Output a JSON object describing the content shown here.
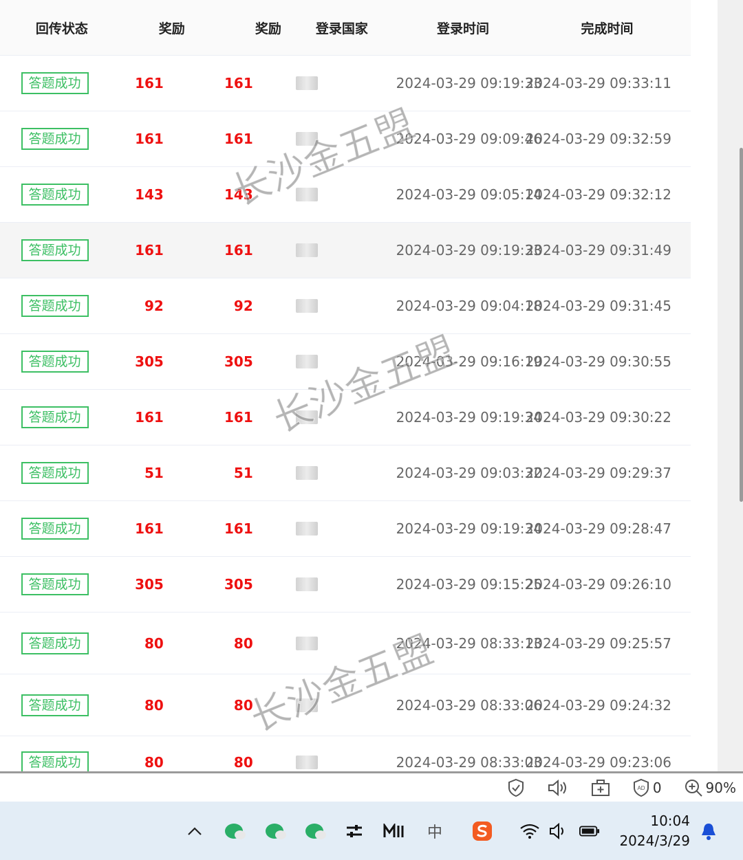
{
  "table": {
    "headers": {
      "status": "回传状态",
      "reward1": "奖励",
      "reward2": "奖励",
      "country": "登录国家",
      "login_time": "登录时间",
      "done_time": "完成时间"
    },
    "rows": [
      {
        "status": "答题成功",
        "reward1": "161",
        "reward2": "161",
        "login": "2024-03-29 09:19:33",
        "done": "2024-03-29 09:33:11"
      },
      {
        "status": "答题成功",
        "reward1": "161",
        "reward2": "161",
        "login": "2024-03-29 09:09:46",
        "done": "2024-03-29 09:32:59"
      },
      {
        "status": "答题成功",
        "reward1": "143",
        "reward2": "143",
        "login": "2024-03-29 09:05:14",
        "done": "2024-03-29 09:32:12"
      },
      {
        "status": "答题成功",
        "reward1": "161",
        "reward2": "161",
        "login": "2024-03-29 09:19:33",
        "done": "2024-03-29 09:31:49"
      },
      {
        "status": "答题成功",
        "reward1": "92",
        "reward2": "92",
        "login": "2024-03-29 09:04:18",
        "done": "2024-03-29 09:31:45"
      },
      {
        "status": "答题成功",
        "reward1": "305",
        "reward2": "305",
        "login": "2024-03-29 09:16:19",
        "done": "2024-03-29 09:30:55"
      },
      {
        "status": "答题成功",
        "reward1": "161",
        "reward2": "161",
        "login": "2024-03-29 09:19:34",
        "done": "2024-03-29 09:30:22"
      },
      {
        "status": "答题成功",
        "reward1": "51",
        "reward2": "51",
        "login": "2024-03-29 09:03:32",
        "done": "2024-03-29 09:29:37"
      },
      {
        "status": "答题成功",
        "reward1": "161",
        "reward2": "161",
        "login": "2024-03-29 09:19:34",
        "done": "2024-03-29 09:28:47"
      },
      {
        "status": "答题成功",
        "reward1": "305",
        "reward2": "305",
        "login": "2024-03-29 09:15:25",
        "done": "2024-03-29 09:26:10"
      },
      {
        "status": "答题成功",
        "reward1": "80",
        "reward2": "80",
        "login": "2024-03-29 08:33:13",
        "done": "2024-03-29 09:25:57"
      },
      {
        "status": "答题成功",
        "reward1": "80",
        "reward2": "80",
        "login": "2024-03-29 08:33:06",
        "done": "2024-03-29 09:24:32"
      },
      {
        "status": "答题成功",
        "reward1": "80",
        "reward2": "80",
        "login": "2024-03-29 08:33:03",
        "done": "2024-03-29 09:23:06"
      }
    ],
    "highlighted_row": 3
  },
  "watermark": "长沙金五盟",
  "statusbar": {
    "adblock_count": "0",
    "zoom": "90%",
    "icons": [
      "shield-check-icon",
      "speaker-icon",
      "add-tab-icon",
      "adblock-icon",
      "zoom-icon"
    ]
  },
  "taskbar": {
    "time": "10:04",
    "date": "2024/3/29",
    "ime": "中",
    "icons": [
      "chevron-up-icon",
      "wechat-icon",
      "wechat-icon",
      "wechat-icon",
      "settings-sliders-icon",
      "m-app-icon",
      "ime-icon",
      "sogou-icon",
      "wifi-icon",
      "volume-icon",
      "battery-icon",
      "notification-bell-icon"
    ]
  },
  "colors": {
    "success_green": "#3cbf63",
    "reward_red": "#ee1111",
    "taskbar_bg": "#e3edf6"
  }
}
